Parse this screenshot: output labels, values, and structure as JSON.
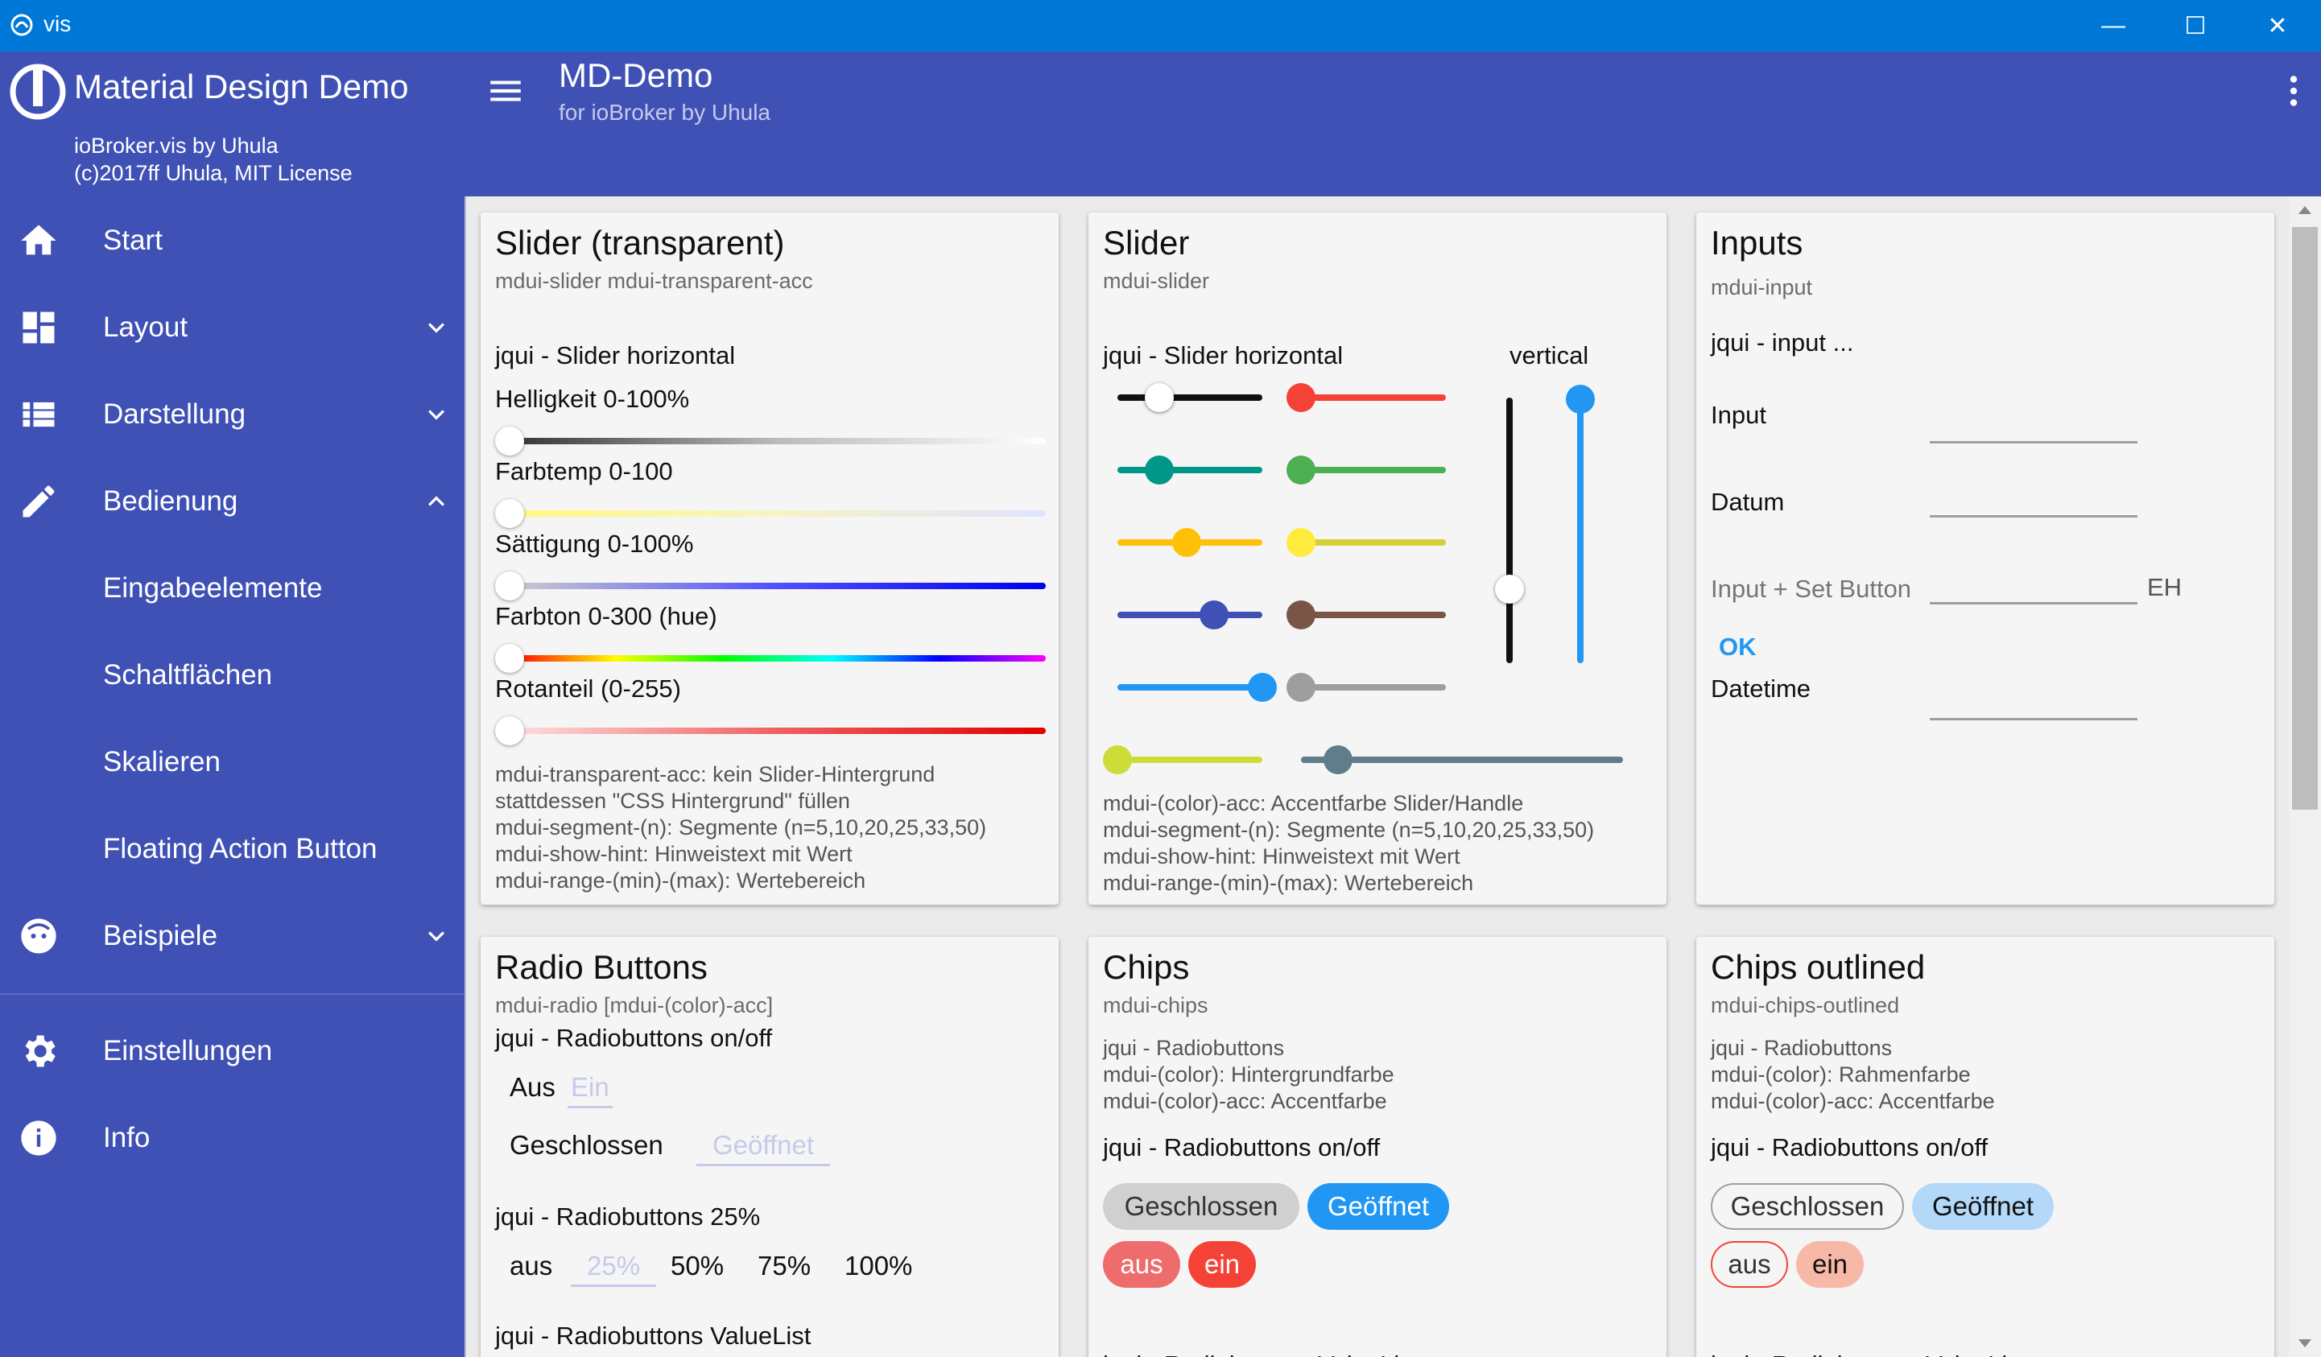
{
  "window": {
    "title": "vis",
    "minimize": "—",
    "maximize": "☐",
    "close": "✕"
  },
  "sidebar": {
    "brand": "Material Design Demo",
    "sub1": "ioBroker.vis by Uhula",
    "sub2": "(c)2017ff Uhula, MIT License",
    "items": [
      {
        "label": "Start",
        "icon": "home-icon"
      },
      {
        "label": "Layout",
        "icon": "dashboard-icon"
      },
      {
        "label": "Darstellung",
        "icon": "list-icon"
      },
      {
        "label": "Bedienung",
        "icon": "pencil-icon"
      },
      {
        "label": "Eingabeelemente"
      },
      {
        "label": "Schaltflächen"
      },
      {
        "label": "Skalieren"
      },
      {
        "label": "Floating Action Button"
      },
      {
        "label": "Beispiele",
        "icon": "face-icon"
      },
      {
        "label": "Einstellungen",
        "icon": "gear-icon"
      },
      {
        "label": "Info",
        "icon": "info-icon"
      }
    ]
  },
  "appbar": {
    "title": "MD-Demo",
    "subtitle": "for ioBroker by Uhula"
  },
  "cards": {
    "slider_transparent": {
      "title": "Slider (transparent)",
      "subtitle": "mdui-slider mdui-transparent-acc",
      "heading": "jqui - Slider horizontal",
      "labels": [
        "Helligkeit 0-100%",
        "Farbtemp 0-100",
        "Sättigung 0-100%",
        "Farbton 0-300 (hue)",
        "Rotanteil (0-255)"
      ],
      "desc": [
        "mdui-transparent-acc: kein Slider-Hintergrund",
        "stattdessen \"CSS Hintergrund\" füllen",
        "mdui-segment-(n): Segmente (n=5,10,20,25,33,50)",
        "mdui-show-hint: Hinweistext mit Wert",
        "mdui-range-(min)-(max): Wertebereich"
      ]
    },
    "slider": {
      "title": "Slider",
      "subtitle": "mdui-slider",
      "heading": "jqui - Slider horizontal",
      "vertical": "vertical",
      "desc": [
        "mdui-(color)-acc: Accentfarbe Slider/Handle",
        "mdui-segment-(n): Segmente (n=5,10,20,25,33,50)",
        "mdui-show-hint: Hinweistext mit Wert",
        "mdui-range-(min)-(max): Wertebereich"
      ]
    },
    "inputs": {
      "title": "Inputs",
      "subtitle": "mdui-input",
      "heading": "jqui - input ...",
      "input": "Input",
      "datum": "Datum",
      "input_set": "Input + Set Button",
      "unit": "EH",
      "ok": "OK",
      "datetime": "Datetime"
    },
    "radio": {
      "title": "Radio Buttons",
      "subtitle": "mdui-radio [mdui-(color)-acc]",
      "h1": "jqui - Radiobuttons on/off",
      "aus": "Aus",
      "ein": "Ein",
      "geschlossen": "Geschlossen",
      "geoeffnet": "Geöffnet",
      "h2": "jqui - Radiobuttons 25%",
      "pct": [
        "aus",
        "25%",
        "50%",
        "75%",
        "100%"
      ],
      "h3": "jqui - Radiobuttons ValueList"
    },
    "chips": {
      "title": "Chips",
      "subtitle": "mdui-chips",
      "desc": [
        "jqui - Radiobuttons",
        "mdui-(color): Hintergrundfarbe",
        "mdui-(color)-acc: Accentfarbe"
      ],
      "h1": "jqui - Radiobuttons on/off",
      "geschlossen": "Geschlossen",
      "geoeffnet": "Geöffnet",
      "aus": "aus",
      "ein": "ein",
      "h2": "jqui - Radiobuttons ValueList"
    },
    "chips_outlined": {
      "title": "Chips outlined",
      "subtitle": "mdui-chips-outlined",
      "desc": [
        "jqui - Radiobuttons",
        "mdui-(color): Rahmenfarbe",
        "mdui-(color)-acc: Accentfarbe"
      ],
      "h1": "jqui - Radiobuttons on/off",
      "geschlossen": "Geschlossen",
      "geoeffnet": "Geöffnet",
      "aus": "aus",
      "ein": "ein",
      "h2": "jqui - Radiobuttons ValueList"
    }
  }
}
